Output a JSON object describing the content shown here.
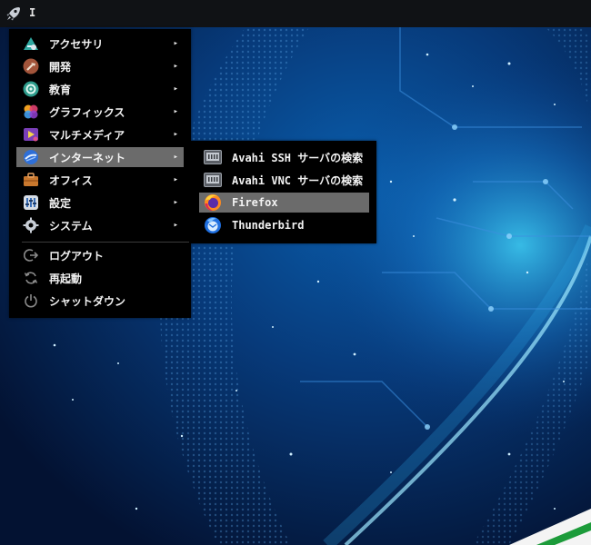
{
  "panel": {
    "launcher_icon": "rocket-icon",
    "title": "I"
  },
  "main_menu": {
    "items": [
      {
        "label": "アクセサリ",
        "icon": "accessories-icon",
        "has_submenu": true
      },
      {
        "label": "開発",
        "icon": "development-icon",
        "has_submenu": true
      },
      {
        "label": "教育",
        "icon": "education-icon",
        "has_submenu": true
      },
      {
        "label": "グラフィックス",
        "icon": "graphics-icon",
        "has_submenu": true
      },
      {
        "label": "マルチメディア",
        "icon": "multimedia-icon",
        "has_submenu": true
      },
      {
        "label": "インターネット",
        "icon": "internet-icon",
        "has_submenu": true,
        "active": true
      },
      {
        "label": "オフィス",
        "icon": "office-icon",
        "has_submenu": true
      },
      {
        "label": "設定",
        "icon": "settings-icon",
        "has_submenu": true
      },
      {
        "label": "システム",
        "icon": "system-icon",
        "has_submenu": true
      }
    ],
    "session_items": [
      {
        "label": "ログアウト",
        "icon": "logout-icon"
      },
      {
        "label": "再起動",
        "icon": "reboot-icon"
      },
      {
        "label": "シャットダウン",
        "icon": "shutdown-icon"
      }
    ],
    "arrow": "▸"
  },
  "internet_submenu": {
    "items": [
      {
        "label": "Avahi SSH サーバの検索",
        "icon": "network-server-icon"
      },
      {
        "label": "Avahi VNC サーバの検索",
        "icon": "network-server-icon"
      },
      {
        "label": "Firefox",
        "icon": "firefox-icon",
        "active": true
      },
      {
        "label": "Thunderbird",
        "icon": "thunderbird-icon"
      }
    ]
  },
  "colors": {
    "panel_bg": "#101215",
    "menu_bg": "#000000",
    "highlight": "#6b6b6b",
    "wallpaper_base": "#04183a",
    "wallpaper_glow": "#1fa4e0"
  }
}
